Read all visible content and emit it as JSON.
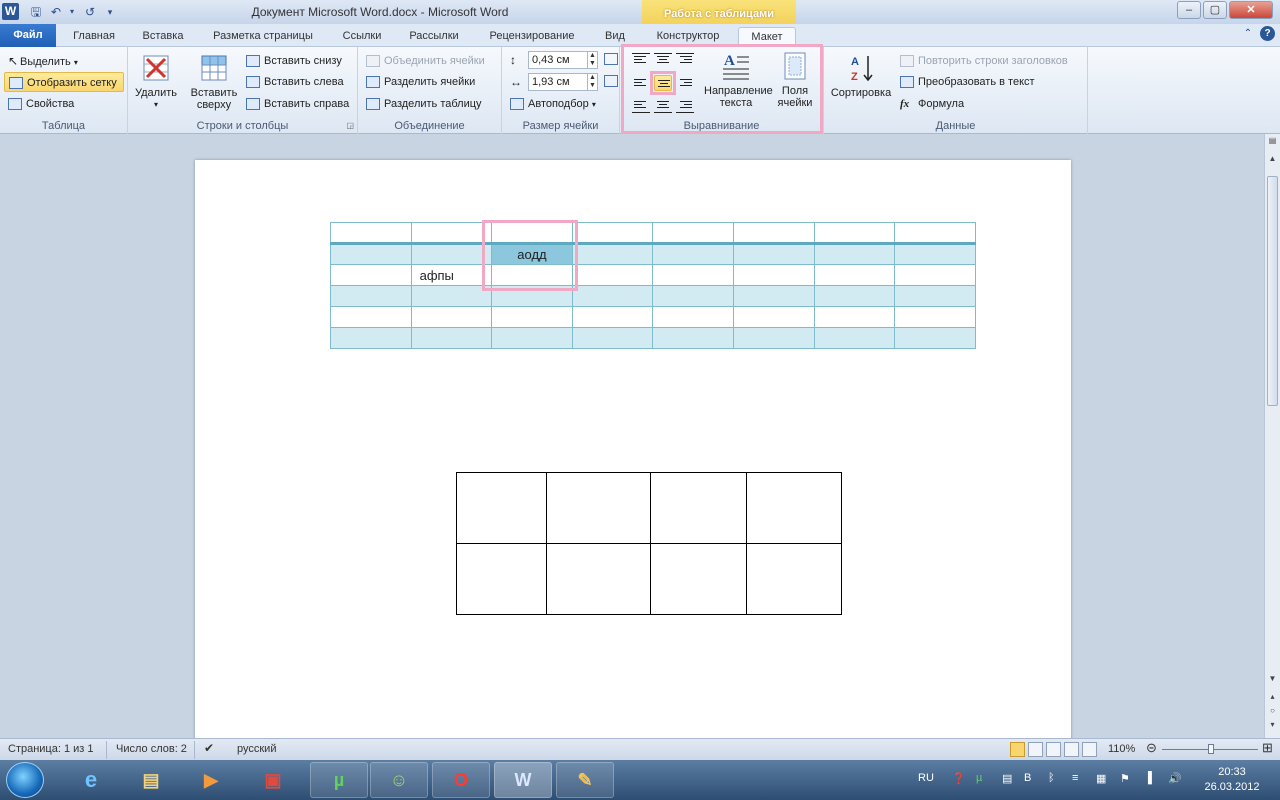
{
  "window": {
    "title": "Документ Microsoft Word.docx  -  Microsoft Word",
    "app_icon_letter": "W",
    "context_group": "Работа с таблицами",
    "controls": {
      "minimize": "–",
      "maximize": "▢",
      "close": "✕"
    }
  },
  "tabs": [
    "Файл",
    "Главная",
    "Вставка",
    "Разметка страницы",
    "Ссылки",
    "Рассылки",
    "Рецензирование",
    "Вид",
    "Конструктор",
    "Макет"
  ],
  "ribbon": {
    "table": {
      "label": "Таблица",
      "select": "Выделить",
      "show_grid": "Отобразить сетку",
      "properties": "Свойства"
    },
    "rows_cols": {
      "label": "Строки и столбцы",
      "delete": "Удалить",
      "insert_above": "Вставить сверху",
      "insert_below": "Вставить снизу",
      "insert_left": "Вставить слева",
      "insert_right": "Вставить справа"
    },
    "merge": {
      "label": "Объединение",
      "merge_cells": "Объединить ячейки",
      "split_cells": "Разделить ячейки",
      "split_table": "Разделить таблицу"
    },
    "cell_size": {
      "label": "Размер ячейки",
      "height": "0,43 см",
      "width": "1,93 см",
      "autofit": "Автоподбор"
    },
    "alignment": {
      "label": "Выравнивание",
      "text_direction": "Направление текста",
      "cell_margins": "Поля ячейки"
    },
    "data": {
      "label": "Данные",
      "sort": "Сортировка",
      "repeat_header": "Повторить строки заголовков",
      "convert_text": "Преобразовать в текст",
      "formula": "Формула"
    }
  },
  "document": {
    "table1": {
      "rows": [
        [
          "",
          "",
          "",
          "",
          "",
          "",
          "",
          ""
        ],
        [
          "",
          "",
          "аодд",
          "",
          "",
          "",
          "",
          ""
        ],
        [
          "",
          "афпы",
          "",
          "",
          "",
          "",
          "",
          ""
        ],
        [
          "",
          "",
          "",
          "",
          "",
          "",
          "",
          ""
        ],
        [
          "",
          "",
          "",
          "",
          "",
          "",
          "",
          ""
        ],
        [
          "",
          "",
          "",
          "",
          "",
          "",
          "",
          ""
        ]
      ]
    },
    "table2": {
      "rows": 2,
      "cols": 4
    }
  },
  "status": {
    "page": "Страница: 1 из 1",
    "words": "Число слов: 2",
    "language": "русский",
    "zoom": "110%"
  },
  "taskbar": {
    "lang": "RU",
    "time": "20:33",
    "date": "26.03.2012"
  },
  "colors": {
    "accent": "#2b5797",
    "selection": "#8cc7dd",
    "highlight": "#f0a8c4"
  }
}
